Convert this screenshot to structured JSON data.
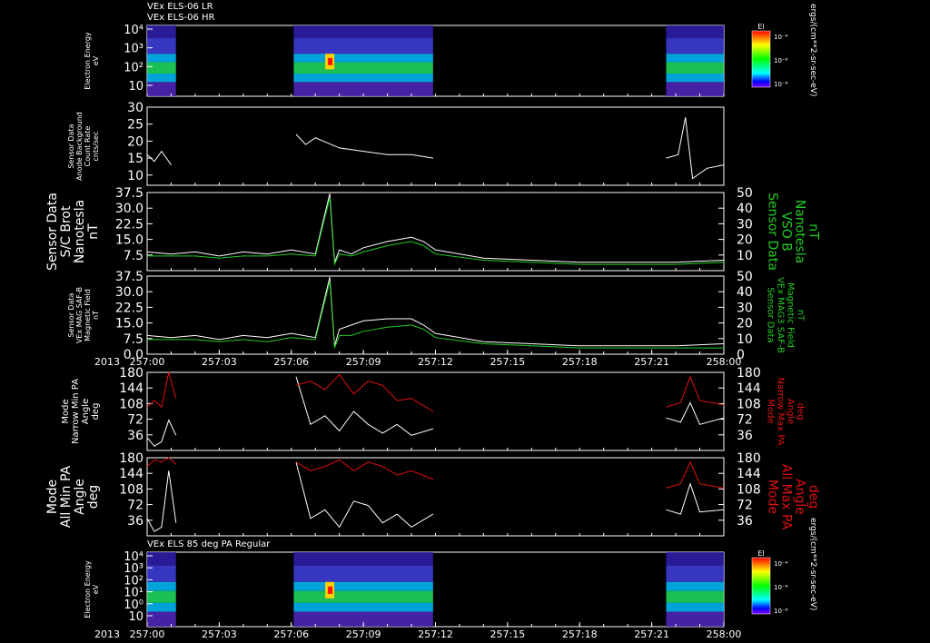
{
  "header": {
    "line1": "VEx ELS-06 LR",
    "line2": "VEx ELS-06 HR"
  },
  "time_axis": {
    "year_label": "2013",
    "ticks": [
      "257:00",
      "257:03",
      "257:06",
      "257:09",
      "257:12",
      "257:15",
      "257:18",
      "257:21",
      "258:00"
    ]
  },
  "colors": {
    "white_trace": "#ffffff",
    "green_trace": "#22cc22",
    "red_trace": "#e01010",
    "frame": "#ffffff",
    "background": "#000000"
  },
  "chart_data": [
    {
      "type": "heatmap",
      "ylabel": [
        "Electron Energy",
        "eV"
      ],
      "y_scale": "log",
      "yticks": [
        "10",
        "10²",
        "10³",
        "10⁴"
      ],
      "colorbar": {
        "title": "El",
        "ticks": [
          "10⁻⁴",
          "10⁻⁶",
          "10⁻⁸"
        ],
        "unit": "ergs/(cm**2-sr-sec-eV)"
      },
      "data_intervals": [
        [
          "257:00.0",
          "257:01.2"
        ],
        [
          "257:06.1",
          "257:11.9"
        ],
        [
          "257:21.6",
          "258:00.0"
        ]
      ]
    },
    {
      "type": "line",
      "ylabel": [
        "Sensor Data",
        "Anode Background",
        "Count Rate",
        "cnts/sec"
      ],
      "ylim": [
        7,
        30
      ],
      "yticks": [
        "10",
        "15",
        "20",
        "25",
        "30"
      ],
      "series": [
        {
          "color": "white",
          "x": [
            "257:00.0",
            "257:00.3",
            "257:00.6",
            "257:01.0",
            "257:06.2",
            "257:06.6",
            "257:07.0",
            "257:08.0",
            "257:09.0",
            "257:10.0",
            "257:11.0",
            "257:11.9",
            "257:21.6",
            "257:22.1",
            "257:22.4",
            "257:22.7",
            "257:23.3",
            "258:00.0"
          ],
          "values": [
            16,
            14,
            17,
            13,
            22,
            19,
            21,
            18,
            17,
            16,
            16,
            15,
            15,
            16,
            27,
            9,
            12,
            13
          ]
        }
      ]
    },
    {
      "type": "line",
      "ylabel": [
        "Sensor Data",
        "S/C Brot",
        "Nanotesla",
        "nT"
      ],
      "ylim": [
        0,
        37.5
      ],
      "yticks": [
        "7.5",
        "15.0",
        "22.5",
        "30.0",
        "37.5"
      ],
      "y2label": [
        "Sensor Data",
        "VSO B",
        "Nanotesla",
        "nT"
      ],
      "y2lim": [
        0,
        50
      ],
      "y2ticks": [
        "10",
        "20",
        "30",
        "40",
        "50"
      ],
      "series": [
        {
          "color": "white",
          "x": [
            "257:00.0",
            "257:01.0",
            "257:02.0",
            "257:03.0",
            "257:04.0",
            "257:05.0",
            "257:06.0",
            "257:07.0",
            "257:07.6",
            "257:07.8",
            "257:08.0",
            "257:08.5",
            "257:09.0",
            "257:10.0",
            "257:11.0",
            "257:11.5",
            "257:12.0",
            "257:14.0",
            "257:16.0",
            "257:18.0",
            "257:20.0",
            "257:22.0",
            "258:00.0"
          ],
          "values": [
            9,
            8,
            9,
            7,
            9,
            8,
            10,
            8,
            37,
            4,
            10,
            8,
            11,
            14,
            16,
            14,
            10,
            6,
            5,
            4,
            4,
            4,
            5
          ]
        },
        {
          "color": "green",
          "x": [
            "257:00.0",
            "257:01.0",
            "257:02.0",
            "257:03.0",
            "257:04.0",
            "257:05.0",
            "257:06.0",
            "257:07.0",
            "257:07.6",
            "257:07.8",
            "257:08.0",
            "257:08.5",
            "257:09.0",
            "257:10.0",
            "257:11.0",
            "257:11.5",
            "257:12.0",
            "257:14.0",
            "257:16.0",
            "257:18.0",
            "257:20.0",
            "257:22.0",
            "258:00.0"
          ],
          "values": [
            7,
            7,
            7,
            6,
            7,
            7,
            8,
            7,
            35,
            3,
            8,
            7,
            9,
            12,
            14,
            12,
            8,
            5,
            4,
            3,
            3,
            3,
            4
          ]
        }
      ]
    },
    {
      "type": "line",
      "ylabel": [
        "Sensor Data",
        "VEx MAG SAF-B",
        "Magnetic Field",
        "nT"
      ],
      "ylim": [
        0,
        37.5
      ],
      "yticks": [
        "0.0",
        "7.5",
        "15.0",
        "22.5",
        "30.0",
        "37.5"
      ],
      "y2label": [
        "Sensor Data",
        "VEx MAG3 SAF-B",
        "Magnetic Field",
        "nT"
      ],
      "y2lim": [
        0,
        50
      ],
      "y2ticks": [
        "0",
        "10",
        "20",
        "30",
        "40",
        "50"
      ],
      "series": [
        {
          "color": "white",
          "x": [
            "257:00.0",
            "257:01.0",
            "257:02.0",
            "257:03.0",
            "257:04.0",
            "257:05.0",
            "257:06.0",
            "257:07.0",
            "257:07.6",
            "257:07.8",
            "257:08.0",
            "257:08.5",
            "257:09.0",
            "257:10.0",
            "257:11.0",
            "257:11.5",
            "257:12.0",
            "257:14.0",
            "257:16.0",
            "257:18.0",
            "257:20.0",
            "257:22.0",
            "258:00.0"
          ],
          "values": [
            9,
            8,
            9,
            7,
            9,
            8,
            10,
            8,
            37,
            4,
            12,
            14,
            16,
            17,
            17,
            14,
            10,
            6,
            5,
            4,
            4,
            4,
            5
          ]
        },
        {
          "color": "green",
          "x": [
            "257:00.0",
            "257:01.0",
            "257:02.0",
            "257:03.0",
            "257:04.0",
            "257:05.0",
            "257:06.0",
            "257:07.0",
            "257:07.6",
            "257:07.8",
            "257:08.0",
            "257:08.5",
            "257:09.0",
            "257:10.0",
            "257:11.0",
            "257:11.5",
            "257:12.0",
            "257:14.0",
            "257:16.0",
            "257:18.0",
            "257:20.0",
            "257:22.0",
            "258:00.0"
          ],
          "values": [
            7,
            7,
            7,
            6,
            7,
            6,
            8,
            7,
            35,
            3,
            9,
            9,
            11,
            13,
            14,
            12,
            8,
            5,
            4,
            3,
            3,
            3,
            3
          ]
        }
      ]
    },
    {
      "type": "line",
      "ylabel": [
        "Mode",
        "Narrow Min PA",
        "Angle",
        "deg"
      ],
      "ylim": [
        0,
        180
      ],
      "yticks": [
        "36",
        "72",
        "108",
        "144",
        "180"
      ],
      "y2label": [
        "Mode",
        "Narrow Max PA",
        "Angle",
        "deg"
      ],
      "y2lim": [
        0,
        180
      ],
      "y2ticks": [
        "36",
        "72",
        "108",
        "144",
        "180"
      ],
      "series": [
        {
          "color": "white",
          "x": [
            "257:00.0",
            "257:00.3",
            "257:00.6",
            "257:00.9",
            "257:01.2",
            "257:06.2",
            "257:06.8",
            "257:07.4",
            "257:08.0",
            "257:08.6",
            "257:09.2",
            "257:09.8",
            "257:10.4",
            "257:11.0",
            "257:11.9",
            "257:21.6",
            "257:22.2",
            "257:22.6",
            "257:23.0",
            "258:00.0"
          ],
          "values": [
            30,
            10,
            20,
            70,
            35,
            170,
            60,
            80,
            45,
            90,
            60,
            40,
            60,
            35,
            50,
            75,
            65,
            110,
            60,
            75
          ]
        },
        {
          "color": "red",
          "x": [
            "257:00.0",
            "257:00.3",
            "257:00.6",
            "257:00.9",
            "257:01.2",
            "257:06.2",
            "257:06.8",
            "257:07.4",
            "257:08.0",
            "257:08.6",
            "257:09.2",
            "257:09.8",
            "257:10.4",
            "257:11.0",
            "257:11.9",
            "257:21.6",
            "257:22.2",
            "257:22.6",
            "257:23.0",
            "258:00.0"
          ],
          "values": [
            100,
            115,
            100,
            180,
            120,
            150,
            160,
            140,
            175,
            130,
            160,
            150,
            115,
            120,
            90,
            100,
            110,
            170,
            115,
            105
          ]
        }
      ]
    },
    {
      "type": "line",
      "ylabel": [
        "Mode",
        "All Min PA",
        "Angle",
        "deg"
      ],
      "ylim": [
        0,
        180
      ],
      "yticks": [
        "36",
        "72",
        "108",
        "144",
        "180"
      ],
      "y2label": [
        "Mode",
        "All Max PA",
        "Angle",
        "deg"
      ],
      "y2lim": [
        0,
        180
      ],
      "y2ticks": [
        "36",
        "72",
        "108",
        "144",
        "180"
      ],
      "series": [
        {
          "color": "white",
          "x": [
            "257:00.0",
            "257:00.3",
            "257:00.6",
            "257:00.9",
            "257:01.2",
            "257:06.2",
            "257:06.8",
            "257:07.4",
            "257:08.0",
            "257:08.6",
            "257:09.2",
            "257:09.8",
            "257:10.4",
            "257:11.0",
            "257:11.9",
            "257:21.6",
            "257:22.2",
            "257:22.6",
            "257:23.0",
            "258:00.0"
          ],
          "values": [
            40,
            10,
            20,
            150,
            30,
            170,
            40,
            60,
            20,
            80,
            70,
            30,
            50,
            20,
            50,
            60,
            50,
            120,
            55,
            60
          ]
        },
        {
          "color": "red",
          "x": [
            "257:00.0",
            "257:00.3",
            "257:00.6",
            "257:00.9",
            "257:01.2",
            "257:06.2",
            "257:06.8",
            "257:07.4",
            "257:08.0",
            "257:08.6",
            "257:09.2",
            "257:09.8",
            "257:10.4",
            "257:11.0",
            "257:11.9",
            "257:21.6",
            "257:22.2",
            "257:22.6",
            "257:23.0",
            "258:00.0"
          ],
          "values": [
            160,
            175,
            170,
            180,
            165,
            170,
            150,
            160,
            175,
            150,
            170,
            160,
            140,
            150,
            130,
            110,
            120,
            170,
            120,
            110
          ]
        }
      ]
    },
    {
      "type": "heatmap",
      "title": "VEx ELS 85 deg PA Regular",
      "ylabel": [
        "Electron Energy",
        "eV"
      ],
      "y_scale": "log",
      "yticks": [
        "10",
        "10⁰",
        "10¹",
        "10²",
        "10³",
        "10⁴"
      ],
      "colorbar": {
        "title": "El",
        "ticks": [
          "10⁻⁴",
          "10⁻⁶",
          "10⁻⁸"
        ],
        "unit": "ergs/(cm**2-sr-sec-eV)"
      },
      "data_intervals": [
        [
          "257:00.0",
          "257:01.2"
        ],
        [
          "257:06.1",
          "257:11.9"
        ],
        [
          "257:21.6",
          "258:00.0"
        ]
      ]
    }
  ]
}
